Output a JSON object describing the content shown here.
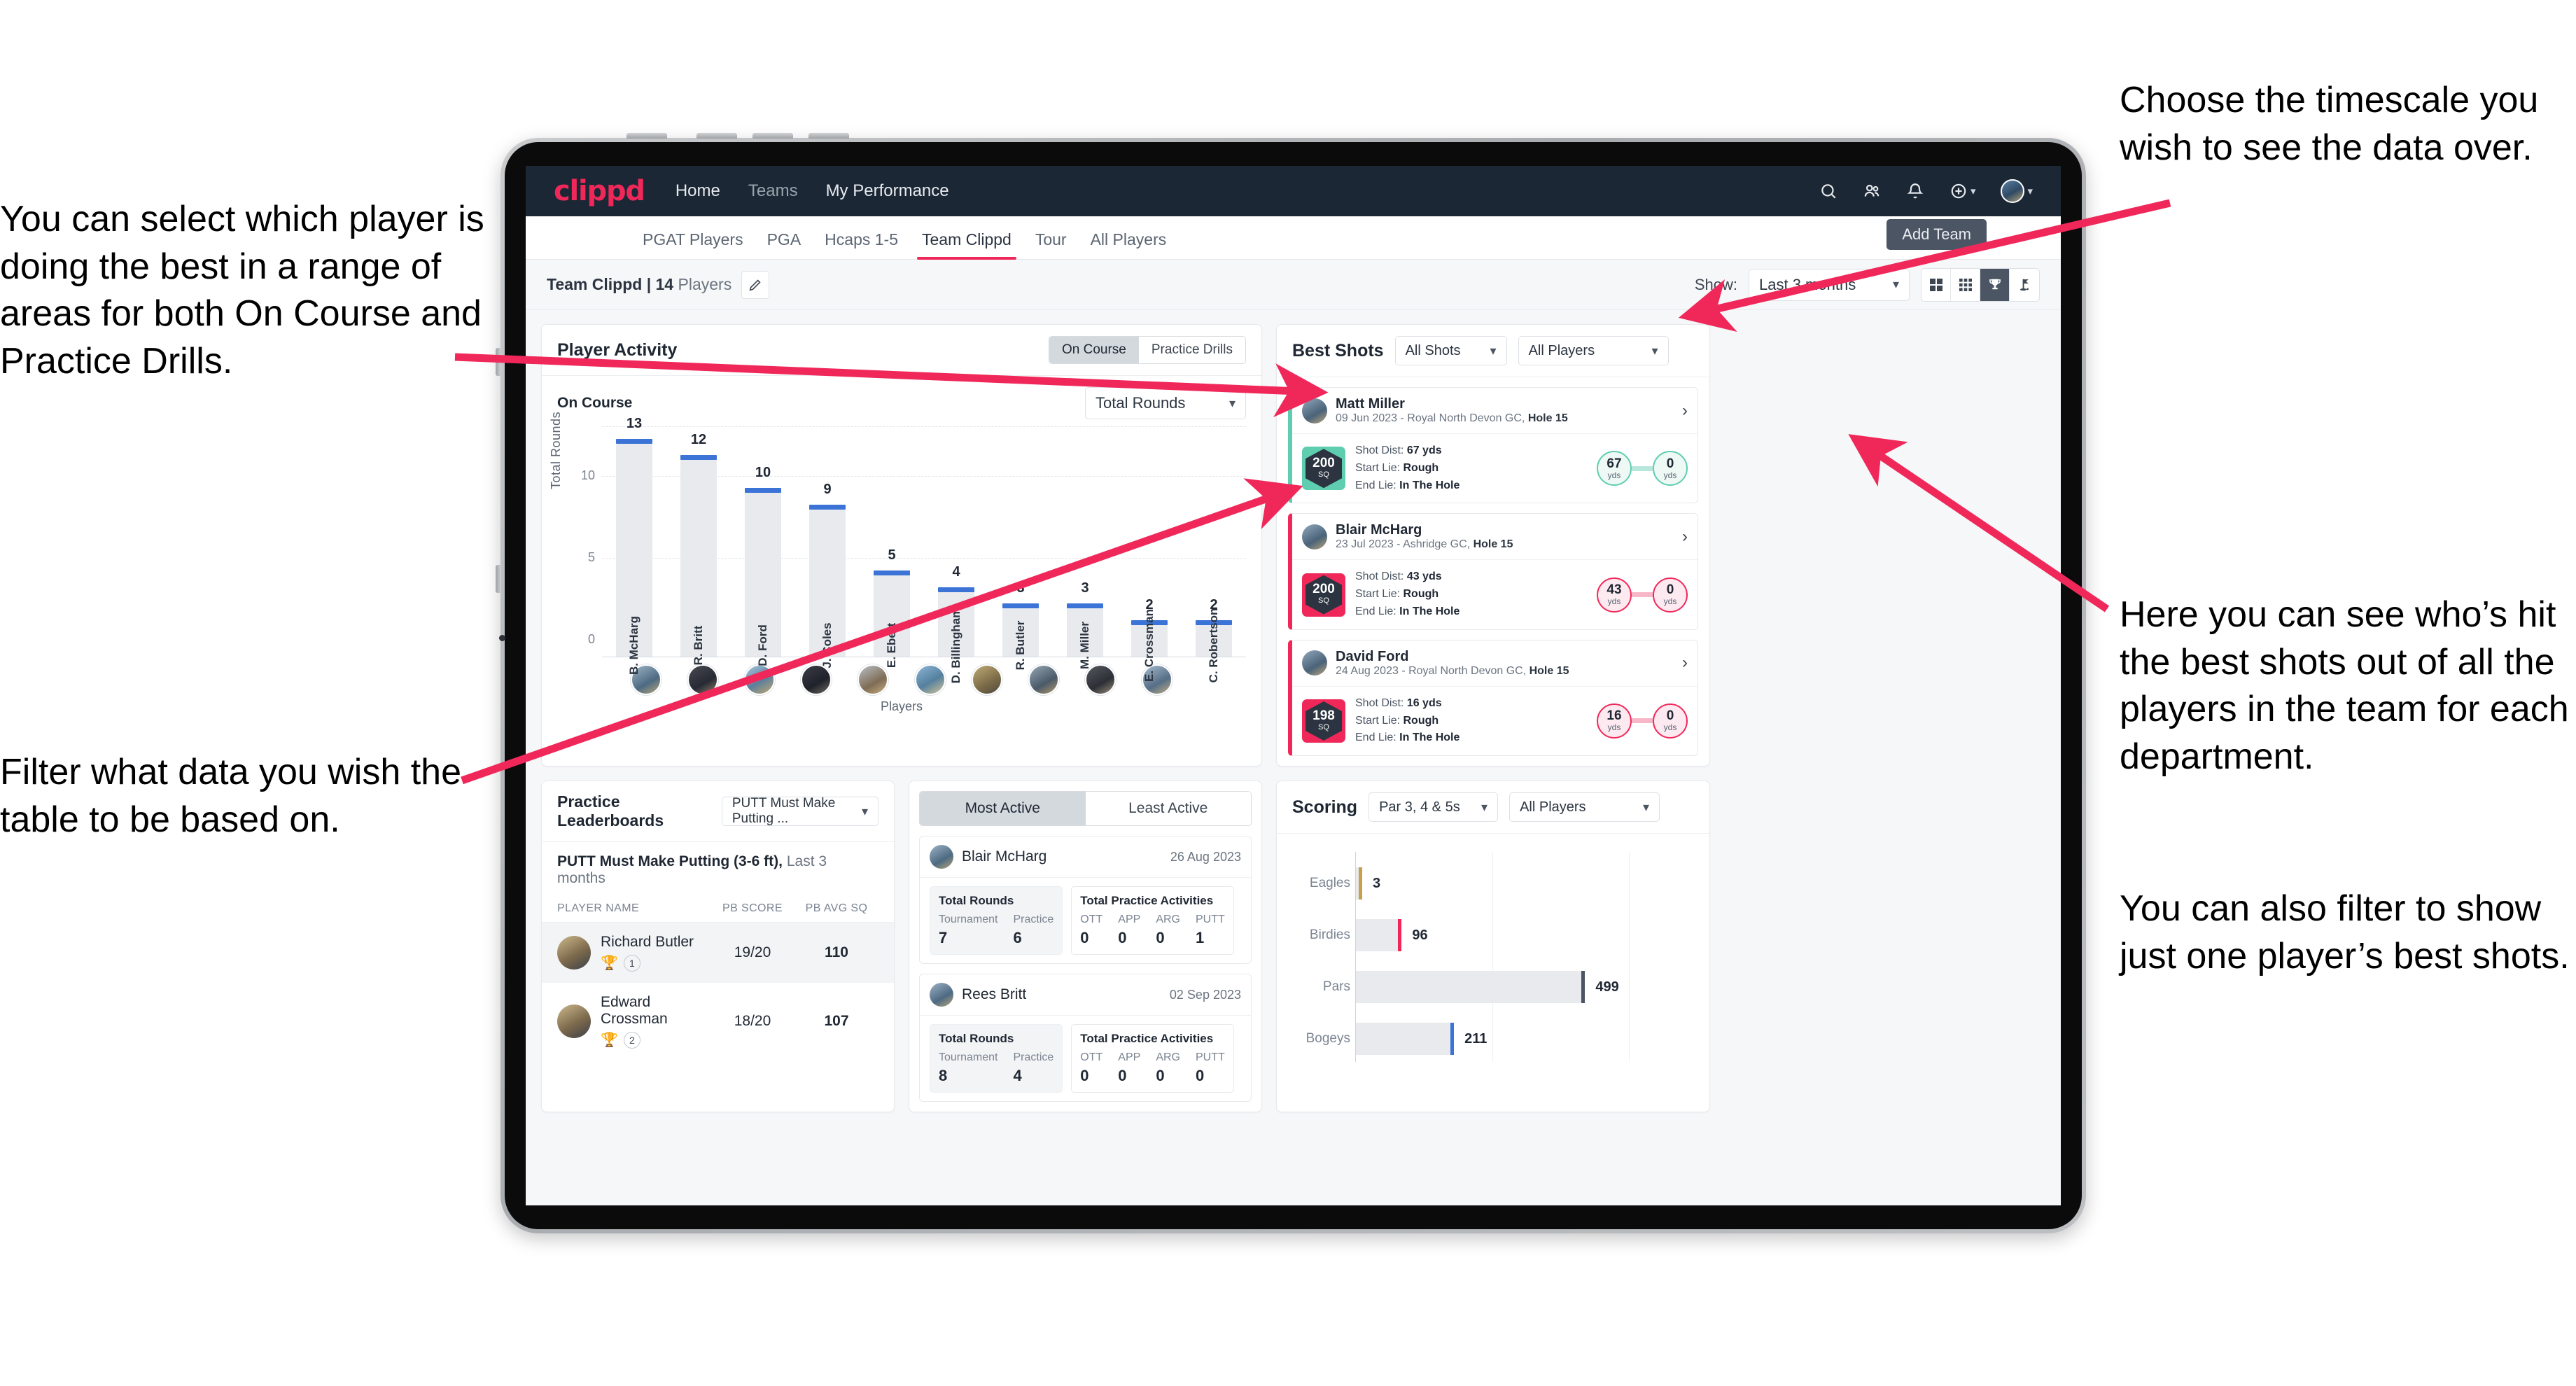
{
  "annotations": {
    "left_top": "You can select which player is doing the best in a range of areas for both On Course and Practice Drills.",
    "left_bottom": "Filter what data you wish the table to be based on.",
    "right_top": "Choose the timescale you wish to see the data over.",
    "right_middle": "Here you can see who’s hit the best shots out of all the players in the team for each department.",
    "right_bottom": "You can also filter to show just one player’s best shots."
  },
  "navbar": {
    "logo": "clippd",
    "links": [
      {
        "label": "Home",
        "active": true
      },
      {
        "label": "Teams",
        "active": false
      },
      {
        "label": "My Performance",
        "active": true
      }
    ],
    "icons": [
      "search-icon",
      "people-icon",
      "bell-icon",
      "plus-circle-icon",
      "avatar"
    ]
  },
  "tabs": [
    {
      "label": "PGAT Players",
      "active": false
    },
    {
      "label": "PGA",
      "active": false
    },
    {
      "label": "Hcaps 1-5",
      "active": false
    },
    {
      "label": "Team Clippd",
      "active": true
    },
    {
      "label": "Tour",
      "active": false
    },
    {
      "label": "All Players",
      "active": false
    }
  ],
  "add_team_button": "Add Team",
  "subbar": {
    "team_label_bold": "Team Clippd | 14",
    "team_label_rest": " Players",
    "edit_icon": "pencil-icon",
    "show_label": "Show:",
    "timescale_value": "Last 3 months",
    "view_modes": [
      {
        "icon": "grid-4-icon",
        "active": false
      },
      {
        "icon": "grid-9-icon",
        "active": false
      },
      {
        "icon": "trophy-icon",
        "active": true
      },
      {
        "icon": "golf-flag-icon",
        "active": false
      }
    ]
  },
  "player_activity": {
    "title": "Player Activity",
    "segmented": [
      {
        "label": "On Course",
        "active": true
      },
      {
        "label": "Practice Drills",
        "active": false
      }
    ],
    "sub_label": "On Course",
    "metric_select": "Total Rounds"
  },
  "best_shots": {
    "title": "Best Shots",
    "filter_shots": "All Shots",
    "filter_players": "All Players",
    "items": [
      {
        "player": "Matt Miller",
        "meta_date": "09 Jun 2023 - Royal North Devon GC, ",
        "meta_hole": "Hole 15",
        "sq": "200",
        "sq_unit": "SQ",
        "shot_dist_label": "Shot Dist: ",
        "shot_dist": "67 yds",
        "start_lie_label": "Start Lie: ",
        "start_lie": "Rough",
        "end_lie_label": "End Lie: ",
        "end_lie": "In The Hole",
        "from_value": "67",
        "from_unit": "yds",
        "to_value": "0",
        "to_unit": "yds",
        "accent": "teal"
      },
      {
        "player": "Blair McHarg",
        "meta_date": "23 Jul 2023 - Ashridge GC, ",
        "meta_hole": "Hole 15",
        "sq": "200",
        "sq_unit": "SQ",
        "shot_dist_label": "Shot Dist: ",
        "shot_dist": "43 yds",
        "start_lie_label": "Start Lie: ",
        "start_lie": "Rough",
        "end_lie_label": "End Lie: ",
        "end_lie": "In The Hole",
        "from_value": "43",
        "from_unit": "yds",
        "to_value": "0",
        "to_unit": "yds",
        "accent": "pink"
      },
      {
        "player": "David Ford",
        "meta_date": "24 Aug 2023 - Royal North Devon GC, ",
        "meta_hole": "Hole 15",
        "sq": "198",
        "sq_unit": "SQ",
        "shot_dist_label": "Shot Dist: ",
        "shot_dist": "16 yds",
        "start_lie_label": "Start Lie: ",
        "start_lie": "Rough",
        "end_lie_label": "End Lie: ",
        "end_lie": "In The Hole",
        "from_value": "16",
        "from_unit": "yds",
        "to_value": "0",
        "to_unit": "yds",
        "accent": "pink"
      }
    ]
  },
  "practice_leaderboards": {
    "title": "Practice Leaderboards",
    "drill_select": "PUTT Must Make Putting ...",
    "subtitle_bold": "PUTT Must Make Putting (3-6 ft),",
    "subtitle_rest": " Last 3 months",
    "columns": [
      "PLAYER NAME",
      "PB SCORE",
      "PB AVG SQ"
    ],
    "rows": [
      {
        "name": "Richard Butler",
        "rank": "1",
        "trophy": "gold",
        "pb_score": "19/20",
        "pb_avg_sq": "110"
      },
      {
        "name": "Edward Crossman",
        "rank": "2",
        "trophy": "silver",
        "pb_score": "18/20",
        "pb_avg_sq": "107"
      }
    ]
  },
  "activity": {
    "tabs": [
      {
        "label": "Most Active",
        "active": true
      },
      {
        "label": "Least Active",
        "active": false
      }
    ],
    "cards": [
      {
        "name": "Blair McHarg",
        "date": "26 Aug 2023",
        "rounds_title": "Total Rounds",
        "rounds": [
          {
            "key": "Tournament",
            "value": "7"
          },
          {
            "key": "Practice",
            "value": "6"
          }
        ],
        "practice_title": "Total Practice Activities",
        "practice": [
          {
            "key": "OTT",
            "value": "0"
          },
          {
            "key": "APP",
            "value": "0"
          },
          {
            "key": "ARG",
            "value": "0"
          },
          {
            "key": "PUTT",
            "value": "1"
          }
        ]
      },
      {
        "name": "Rees Britt",
        "date": "02 Sep 2023",
        "rounds_title": "Total Rounds",
        "rounds": [
          {
            "key": "Tournament",
            "value": "8"
          },
          {
            "key": "Practice",
            "value": "4"
          }
        ],
        "practice_title": "Total Practice Activities",
        "practice": [
          {
            "key": "OTT",
            "value": "0"
          },
          {
            "key": "APP",
            "value": "0"
          },
          {
            "key": "ARG",
            "value": "0"
          },
          {
            "key": "PUTT",
            "value": "0"
          }
        ]
      }
    ]
  },
  "scoring": {
    "title": "Scoring",
    "filter_par": "Par 3, 4 & 5s",
    "filter_players": "All Players"
  },
  "colors": {
    "brand_pink": "#f0285a",
    "nav_dark": "#1b2735",
    "bar_blue": "#3b73d6",
    "teal": "#5ecdb0",
    "gold": "#c6a04a"
  },
  "chart_data": [
    {
      "type": "bar",
      "title": "Player Activity - On Course",
      "xlabel": "Players",
      "ylabel": "Total Rounds",
      "ylim": [
        0,
        14
      ],
      "yticks": [
        0,
        5,
        10
      ],
      "grid": true,
      "categories": [
        "B. McHarg",
        "R. Britt",
        "D. Ford",
        "J. Coles",
        "E. Ebert",
        "D. Billingham",
        "R. Butler",
        "M. Miller",
        "E. Crossman",
        "C. Robertson"
      ],
      "values": [
        13,
        12,
        10,
        9,
        5,
        4,
        3,
        3,
        2,
        2
      ]
    },
    {
      "type": "bar",
      "orientation": "horizontal",
      "title": "Scoring",
      "xlabel": "",
      "ylabel": "",
      "xlim": [
        0,
        600
      ],
      "grid": true,
      "categories": [
        "Eagles",
        "Birdies",
        "Pars",
        "Bogeys"
      ],
      "values": [
        3,
        96,
        499,
        211
      ],
      "bar_tip_colors": [
        "#c6a04a",
        "#f0285a",
        "#4b5563",
        "#3b73d6"
      ]
    }
  ]
}
